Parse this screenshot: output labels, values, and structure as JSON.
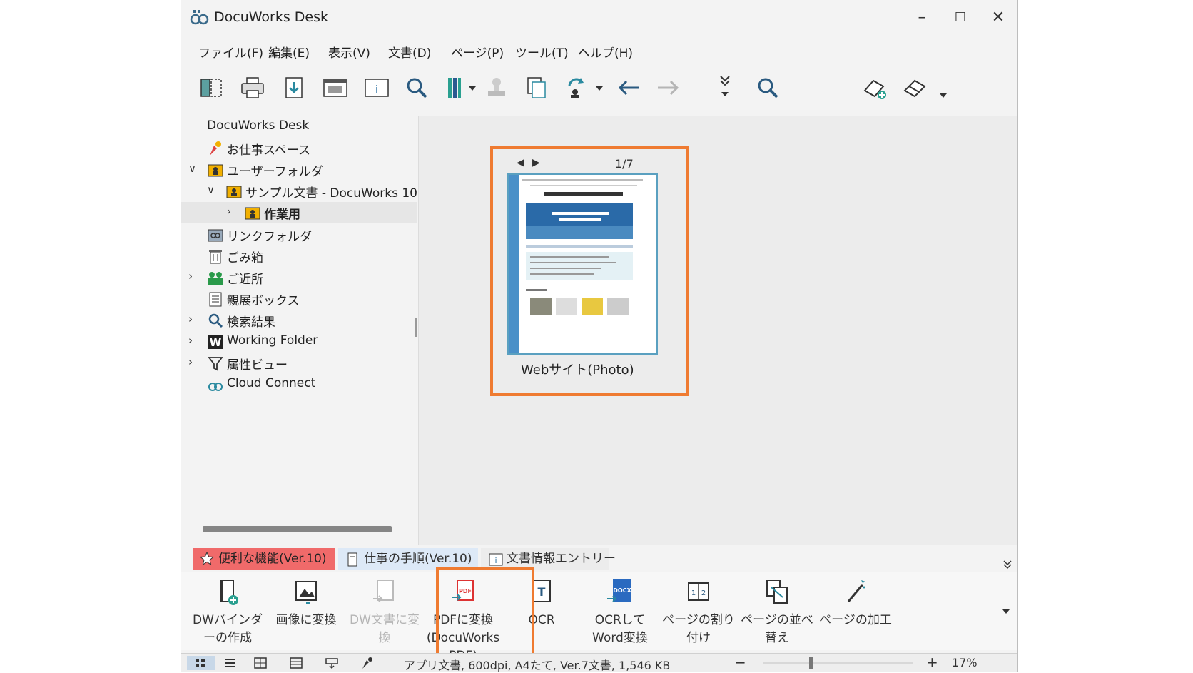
{
  "window": {
    "title": "DocuWorks Desk",
    "minimize": "–",
    "maximize": "☐",
    "close": "✕"
  },
  "menu": [
    "ファイル(F)",
    "編集(E)",
    "表示(V)",
    "文書(D)",
    "ページ(P)",
    "ツール(T)",
    "ヘルプ(H)"
  ],
  "toolbar": {
    "icons": [
      "split-view-icon",
      "print-icon",
      "download-icon",
      "viewer-icon",
      "info-icon",
      "zoom-icon",
      "binder-icon",
      "dropdown-icon",
      "stamp-icon",
      "copy-icon",
      "rotate-icon",
      "dropdown-icon",
      "back-arrow-icon",
      "forward-arrow-icon",
      "more-icon",
      "search-icon",
      "cloud-add-icon",
      "eraser-icon",
      "overflow-icon"
    ]
  },
  "tree": [
    {
      "label": "DocuWorks Desk",
      "icon": "none",
      "chev": ""
    },
    {
      "label": "お仕事スペース",
      "icon": "workspace-icon",
      "chev": ""
    },
    {
      "label": "ユーザーフォルダ",
      "icon": "user-folder-icon",
      "chev": "∨"
    },
    {
      "label": "サンプル文書 - DocuWorks 10",
      "icon": "user-folder-icon",
      "chev": "∨"
    },
    {
      "label": "作業用",
      "icon": "user-folder-icon",
      "chev": "›"
    },
    {
      "label": "リンクフォルダ",
      "icon": "link-folder-icon",
      "chev": ""
    },
    {
      "label": "ごみ箱",
      "icon": "trash-icon",
      "chev": ""
    },
    {
      "label": "ご近所",
      "icon": "neighbors-icon",
      "chev": "›"
    },
    {
      "label": "親展ボックス",
      "icon": "confidential-box-icon",
      "chev": ""
    },
    {
      "label": "検索結果",
      "icon": "search-results-icon",
      "chev": "›"
    },
    {
      "label": "Working Folder",
      "icon": "working-folder-icon",
      "chev": "›"
    },
    {
      "label": "属性ビュー",
      "icon": "filter-icon",
      "chev": "›"
    },
    {
      "label": "Cloud Connect",
      "icon": "cloud-connect-icon",
      "chev": ""
    }
  ],
  "document": {
    "name": "Webサイト(Photo)",
    "page_counter": "1/7",
    "prev": "◀",
    "next": "▶"
  },
  "ribbon_tabs": [
    "便利な機能(Ver.10)",
    "仕事の手順(Ver.10)",
    "文書情報エントリー"
  ],
  "ribbon_buttons": [
    {
      "label": "DWバインダーの作成",
      "icon": "binder-create-icon",
      "enabled": true
    },
    {
      "label": "画像に変換",
      "icon": "image-convert-icon",
      "enabled": true
    },
    {
      "label": "DW文書に変換",
      "icon": "dw-convert-icon",
      "enabled": false
    },
    {
      "label": "PDFに変換(DocuWorks PDF)",
      "icon": "pdf-convert-icon",
      "enabled": true
    },
    {
      "label": "OCR",
      "icon": "ocr-icon",
      "enabled": true
    },
    {
      "label": "OCRしてWord変換",
      "icon": "docx-convert-icon",
      "enabled": true
    },
    {
      "label": "ページの割り付け",
      "icon": "page-layout-icon",
      "enabled": true
    },
    {
      "label": "ページの並べ替え",
      "icon": "page-sort-icon",
      "enabled": true
    },
    {
      "label": "ページの加工",
      "icon": "page-edit-icon",
      "enabled": true
    }
  ],
  "status": {
    "text": "アプリ文書, 600dpi, A4たて, Ver.7文書, 1,546 KB",
    "zoom": "17%",
    "zoom_minus": "−",
    "zoom_plus": "+"
  },
  "colors": {
    "highlight": "#ef7b31",
    "active_tab": "#f06a6a",
    "tab": "#dde9f7"
  }
}
